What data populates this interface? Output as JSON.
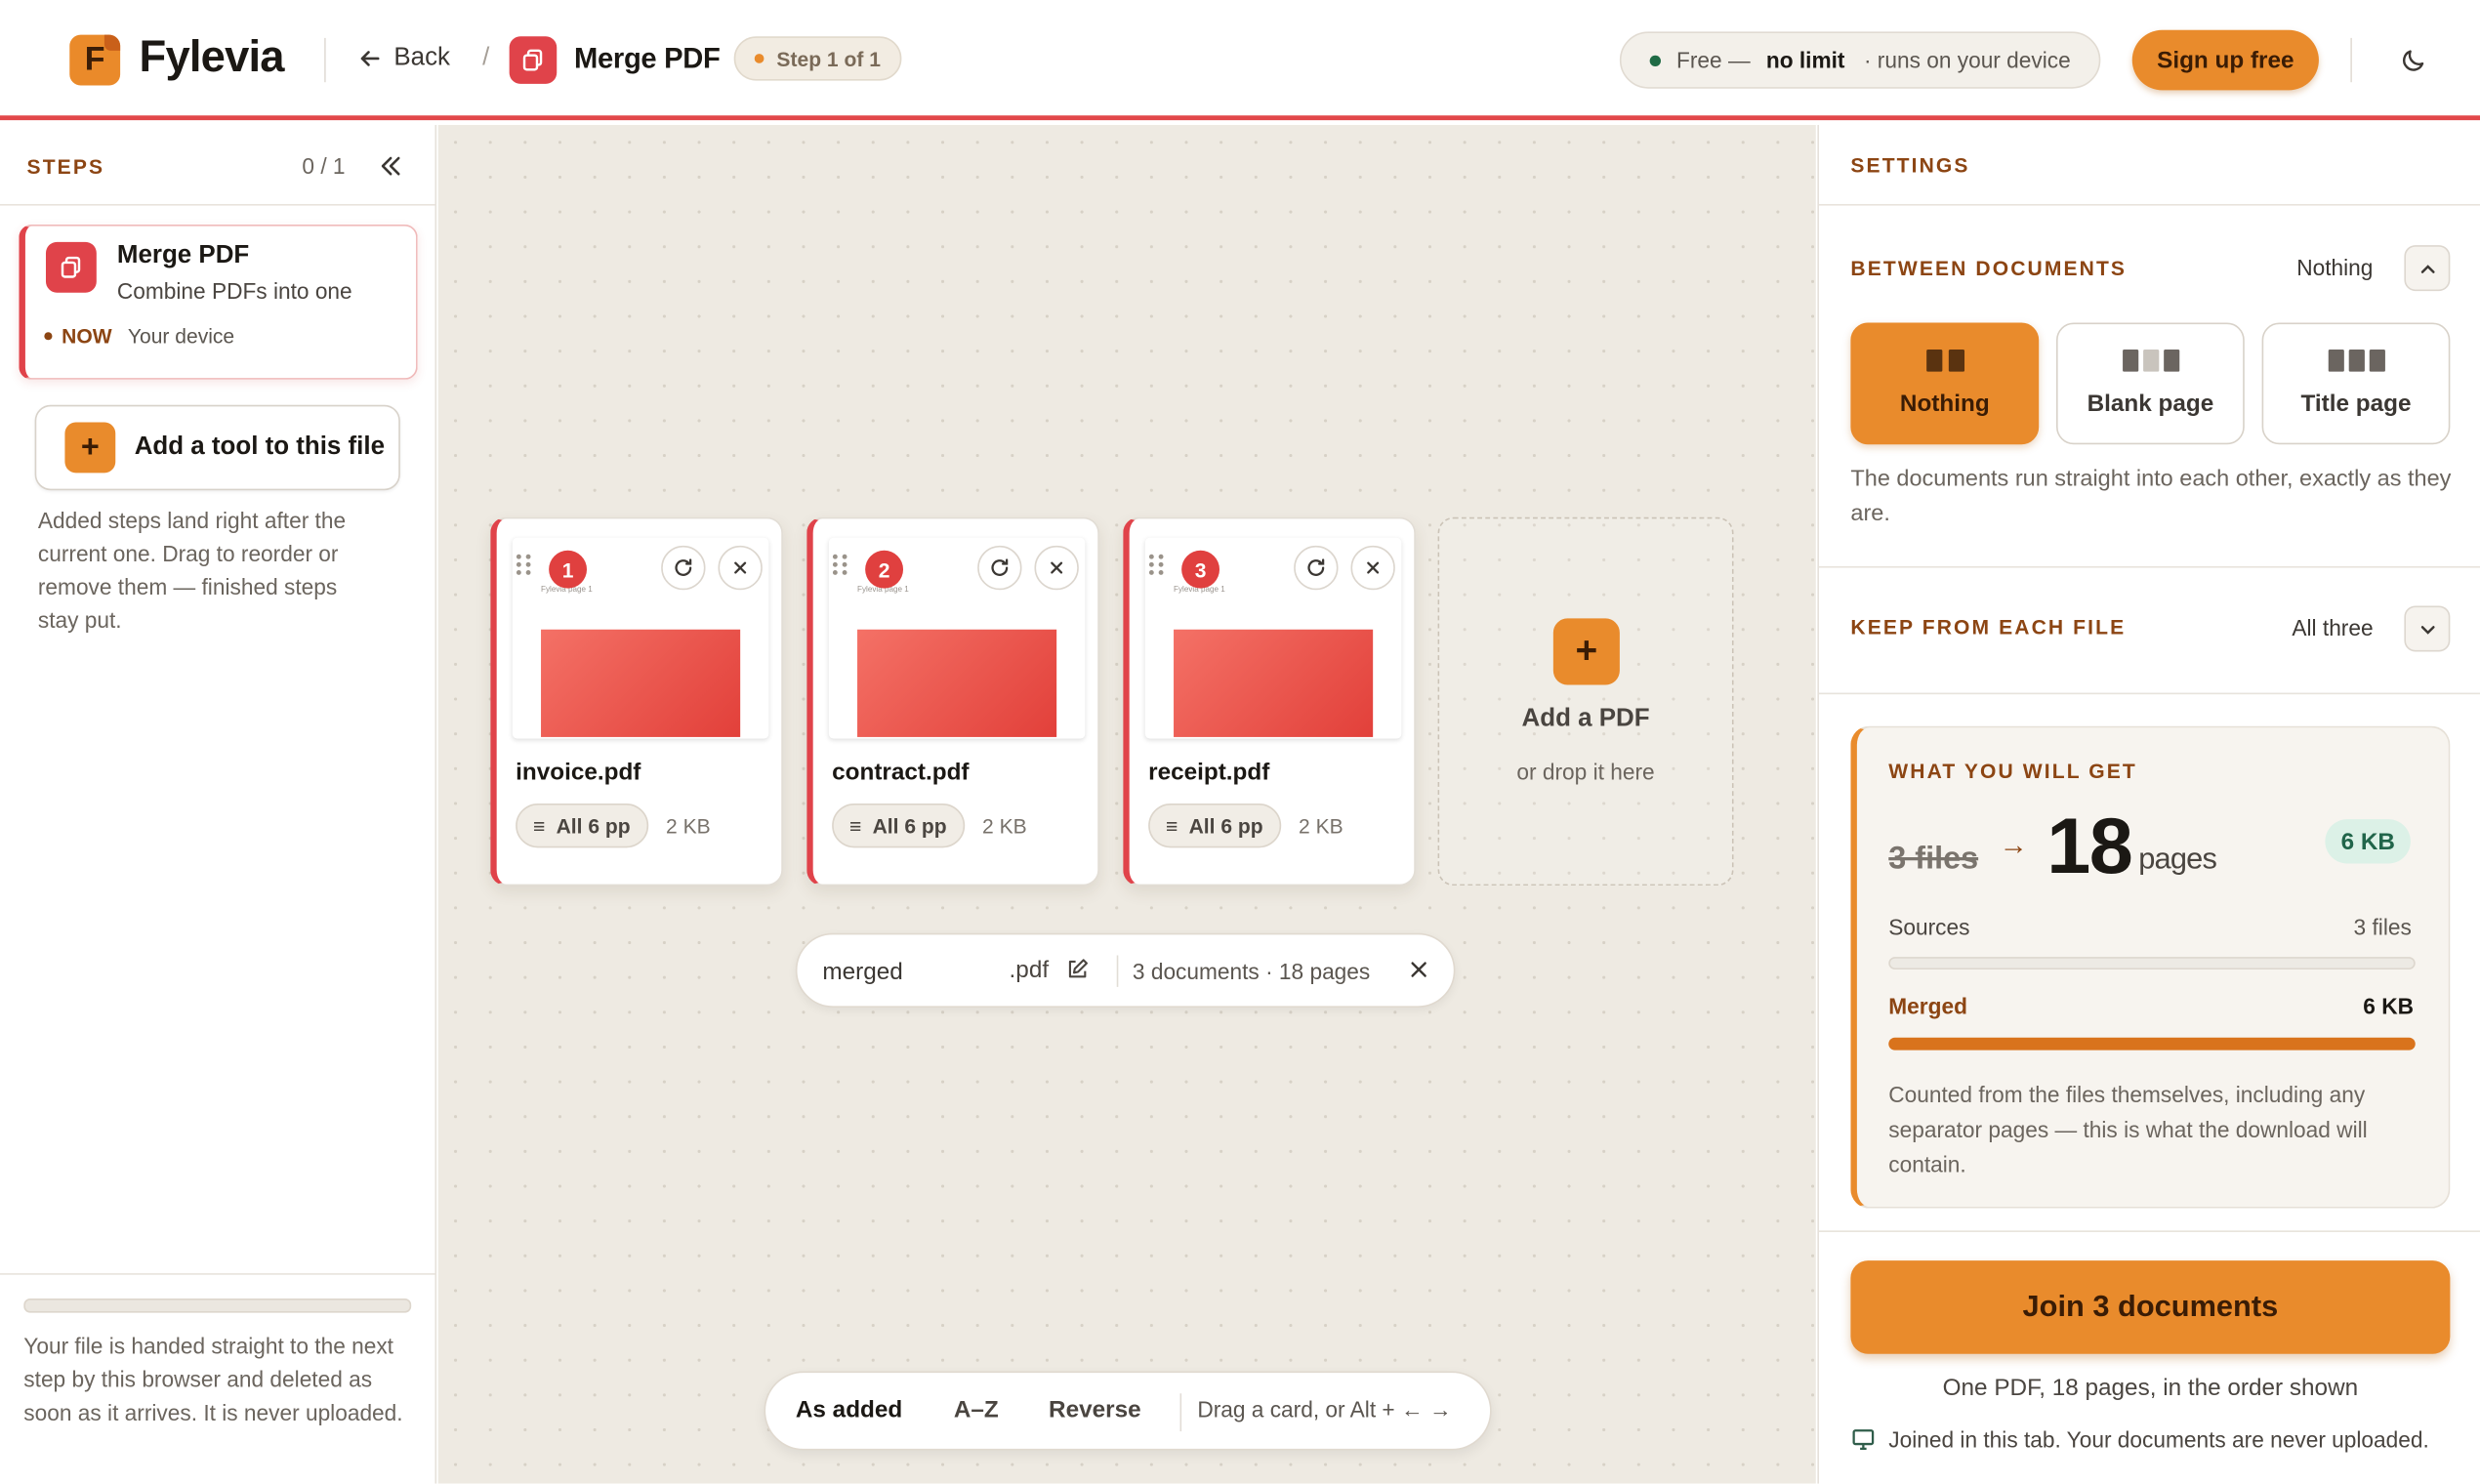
{
  "app": {
    "name": "Fylevia",
    "logo_letter": "F",
    "accent": "#e98b2c",
    "tool_red": "#e0434a"
  },
  "header": {
    "back_label": "Back",
    "tool_title": "Merge PDF",
    "step_pill": "Step 1 of 1",
    "status_free": "Free —",
    "status_limit": "no limit",
    "status_device": "· runs on your device",
    "signup_label": "Sign up free",
    "theme_icon": "moon-icon"
  },
  "left": {
    "label": "STEPS",
    "count": "0 / 1",
    "step": {
      "title": "Merge PDF",
      "subtitle": "Combine PDFs into one",
      "when": "NOW",
      "where": "Your device"
    },
    "add_tool_label": "Add a tool to this file",
    "add_tool_help": "Added steps land right after the current one. Drag to reorder or remove them — finished steps stay put.",
    "footer_note": "Your file is handed straight to the next step by this browser and deleted as soon as it arrives. It is never uploaded."
  },
  "canvas": {
    "files": [
      {
        "num": "1",
        "name": "invoice.pdf",
        "pages": "All 6 pp",
        "size": "2 KB",
        "thumb_caption": "Fylevia page 1"
      },
      {
        "num": "2",
        "name": "contract.pdf",
        "pages": "All 6 pp",
        "size": "2 KB",
        "thumb_caption": "Fylevia page 1"
      },
      {
        "num": "3",
        "name": "receipt.pdf",
        "pages": "All 6 pp",
        "size": "2 KB",
        "thumb_caption": "Fylevia page 1"
      }
    ],
    "add_pdf": {
      "title": "Add a PDF",
      "subtitle": "or drop it here"
    },
    "output": {
      "name": "merged",
      "ext": ".pdf",
      "summary": "3 documents · 18 pages"
    },
    "sort": {
      "options": [
        "As added",
        "A–Z",
        "Reverse"
      ],
      "selected": "As added",
      "hint": "Drag a card, or Alt + ← →"
    }
  },
  "settings": {
    "label": "SETTINGS",
    "between": {
      "label": "BETWEEN DOCUMENTS",
      "value": "Nothing",
      "options": [
        "Nothing",
        "Blank page",
        "Title page"
      ],
      "selected": "Nothing",
      "help": "The documents run straight into each other, exactly as they are."
    },
    "keep": {
      "label": "KEEP FROM EACH FILE",
      "value": "All three"
    },
    "result": {
      "label": "WHAT YOU WILL GET",
      "from": "3 files",
      "pages_num": "18",
      "pages_unit": "pages",
      "size_badge": "6 KB",
      "sources_label": "Sources",
      "sources_value": "3 files",
      "merged_label": "Merged",
      "merged_value": "6 KB",
      "merged_fill": 1.0,
      "note": "Counted from the files themselves, including any separator pages — this is what the download will contain."
    },
    "join_label": "Join 3 documents",
    "join_sub": "One PDF, 18 pages, in the order shown",
    "privacy": "Joined in this tab. Your documents are never uploaded."
  }
}
